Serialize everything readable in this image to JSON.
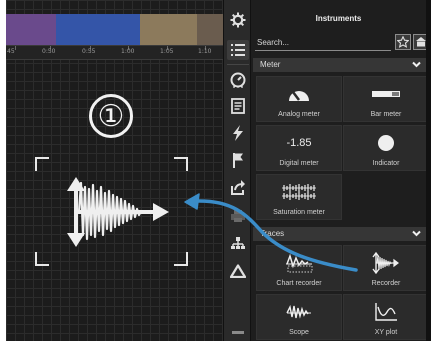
{
  "timeline": {
    "segments": [
      {
        "color": "#6a4a8c",
        "width": 50
      },
      {
        "color": "#3455a8",
        "width": 84
      },
      {
        "color": "#8c7a5c",
        "width": 57
      },
      {
        "color": "#6a5c4e",
        "width": 26
      }
    ],
    "ticks": [
      "45",
      "0:50",
      "0:55",
      "1:00",
      "1:05",
      "1:10"
    ]
  },
  "canvas": {
    "step_number": "①",
    "drop_target_icon": "recorder-waveform-icon"
  },
  "toolbar": {
    "icons": [
      "gear-icon",
      "list-icon",
      "gauge-icon",
      "notes-icon",
      "lightning-icon",
      "flag-icon",
      "export-icon",
      "printer-icon",
      "network-icon",
      "triangle-icon"
    ]
  },
  "panel": {
    "title": "Instruments",
    "search_placeholder": "Search...",
    "sections": {
      "meter": {
        "label": "Meter",
        "items": [
          {
            "label": "Analog meter",
            "icon": "analog-meter-icon"
          },
          {
            "label": "Bar meter",
            "icon": "bar-meter-icon"
          },
          {
            "label": "Digital meter",
            "icon": "digital-meter-icon",
            "value": "-1.85"
          },
          {
            "label": "Indicator",
            "icon": "indicator-icon"
          },
          {
            "label": "Saturation meter",
            "icon": "saturation-meter-icon"
          }
        ]
      },
      "traces": {
        "label": "Traces",
        "items": [
          {
            "label": "Chart recorder",
            "icon": "chart-recorder-icon"
          },
          {
            "label": "Recorder",
            "icon": "recorder-icon"
          },
          {
            "label": "Scope",
            "icon": "scope-icon"
          },
          {
            "label": "XY plot",
            "icon": "xy-plot-icon"
          }
        ]
      }
    }
  },
  "colors": {
    "drag_arrow": "#3a8cc8",
    "background": "#1c1c1c"
  }
}
